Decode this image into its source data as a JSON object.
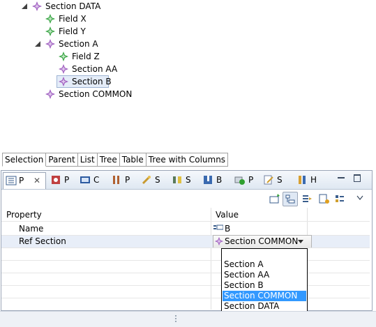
{
  "tree": {
    "items": [
      {
        "label": "Section DATA",
        "expanded": true,
        "icon": "section-icon"
      },
      {
        "label": "Field X",
        "icon": "field-icon"
      },
      {
        "label": "Field Y",
        "icon": "field-icon"
      },
      {
        "label": "Section A",
        "expanded": true,
        "icon": "section-icon"
      },
      {
        "label": "Field Z",
        "icon": "field-icon"
      },
      {
        "label": "Section AA",
        "icon": "section-icon"
      },
      {
        "label": "Section B",
        "icon": "section-icon",
        "selected": true
      },
      {
        "label": "Section COMMON",
        "icon": "section-icon"
      }
    ]
  },
  "view_tabs": [
    "Selection",
    "Parent",
    "List",
    "Tree",
    "Table",
    "Tree with Columns"
  ],
  "properties_tabs": [
    {
      "label": "P",
      "icon": "properties-icon",
      "active": true
    },
    {
      "label": "P",
      "icon": "plugin-icon"
    },
    {
      "label": "C",
      "icon": "console-icon"
    },
    {
      "label": "P",
      "icon": "progress-icon"
    },
    {
      "label": "S",
      "icon": "search-icon"
    },
    {
      "label": "S",
      "icon": "synchronize-icon"
    },
    {
      "label": "B",
      "icon": "bookmarks-icon"
    },
    {
      "label": "P",
      "icon": "problems-icon"
    },
    {
      "label": "S",
      "icon": "snippets-icon"
    },
    {
      "label": "H",
      "icon": "history-icon"
    }
  ],
  "table": {
    "columns": [
      "Property",
      "Value"
    ],
    "rows": [
      {
        "property": "Name",
        "value": "B"
      },
      {
        "property": "Ref Section",
        "value": "Section COMMON"
      }
    ]
  },
  "dropdown": {
    "options": [
      "Section A",
      "Section AA",
      "Section B",
      "Section COMMON",
      "Section DATA"
    ],
    "selected": "Section COMMON"
  },
  "colors": {
    "field_icon": "#3aa545",
    "section_icon": "#a060c0",
    "selection": "#3399ff"
  }
}
